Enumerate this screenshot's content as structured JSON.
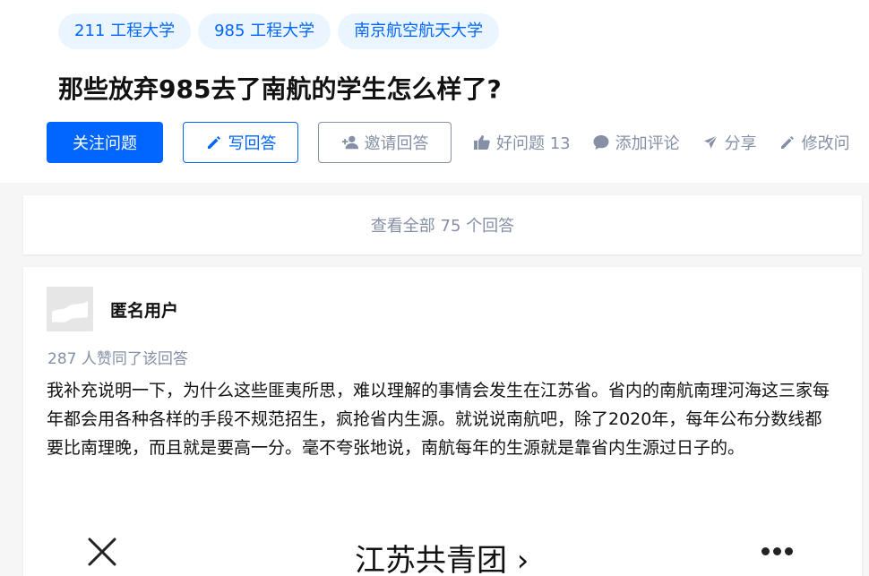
{
  "question": {
    "topics": [
      "211 工程大学",
      "985 工程大学",
      "南京航空航天大学"
    ],
    "title": "那些放弃985去了南航的学生怎么样了?"
  },
  "actions": {
    "follow_label": "关注问题",
    "write_label": "写回答",
    "invite_label": "邀请回答",
    "good_question_label": "好问题 13",
    "comment_label": "添加评论",
    "share_label": "分享",
    "edit_label": "修改问"
  },
  "view_all": "查看全部 75 个回答",
  "answer": {
    "author": "匿名用户",
    "votes": "287 人赞同了该回答",
    "content": "我补充说明一下，为什么这些匪夷所思，难以理解的事情会发生在江苏省。省内的南航南理河海这三家每年都会用各种各样的手段不规范招生，疯抢省内生源。就说说南航吧，除了2020年，每年公布分数线都要比南理晚，而且就是要高一分。毫不夸张地说，南航每年的生源就是靠省内生源过日子的。",
    "embed_title": "江苏共青团 ›"
  },
  "colors": {
    "brand": "#0066ff",
    "muted": "#8590a6",
    "topic_bg": "#ebf5ff"
  }
}
